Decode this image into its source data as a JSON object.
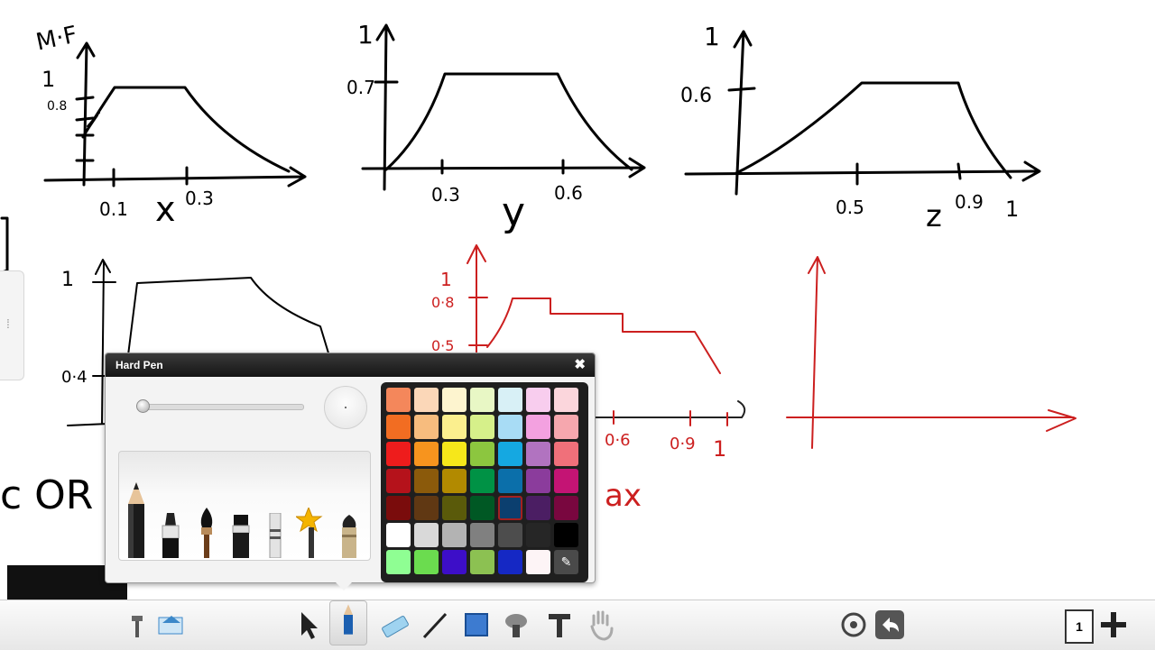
{
  "board": {
    "graph_x": {
      "axis_label": "M·F",
      "y_labels": [
        "1",
        "0.8"
      ],
      "x_labels": [
        "0.1",
        "0.3"
      ],
      "var": "x"
    },
    "graph_y": {
      "y_labels": [
        "1",
        "0.7"
      ],
      "x_labels": [
        "0.3",
        "0.6"
      ],
      "var": "y"
    },
    "graph_z": {
      "y_labels": [
        "1",
        "0.6"
      ],
      "x_labels": [
        "0.5",
        "0.9",
        "1"
      ],
      "var": "z"
    },
    "graph_left": {
      "y_labels": [
        "1",
        "0·4"
      ]
    },
    "graph_red": {
      "y_labels": [
        "1",
        "0·8",
        "0·5"
      ],
      "x_labels": [
        "0·6",
        "0·9",
        "1"
      ],
      "note": "ax"
    },
    "bottom_text": "c OR"
  },
  "pen_panel": {
    "title": "Hard Pen",
    "close_icon": "close-icon",
    "swatches": [
      [
        "#f4875b",
        "#fbd7b8",
        "#fdf4cf",
        "#e8f7c5",
        "#d8f0f6",
        "#f8cdee",
        "#fbd6dc"
      ],
      [
        "#f26d22",
        "#f7bc7e",
        "#fbef8e",
        "#d6f08a",
        "#a8dcf5",
        "#f3a1e0",
        "#f6a7ae"
      ],
      [
        "#ee1c1c",
        "#f7941e",
        "#f6e71a",
        "#8cc63f",
        "#15a8e1",
        "#b173c0",
        "#f0707a"
      ],
      [
        "#b5121b",
        "#8b5a0b",
        "#b28a00",
        "#009245",
        "#0b6faa",
        "#8b3c9c",
        "#c41474"
      ],
      [
        "#7a0c0c",
        "#603813",
        "#5a5a0a",
        "#005824",
        "#0b3f6f",
        "#4b1e63",
        "#79073f"
      ],
      [
        "#ffffff",
        "#d9d9d9",
        "#b3b3b3",
        "#808080",
        "#4d4d4d",
        "#262626",
        "#000000"
      ],
      [
        "#8ffe93",
        "#6bdc4f",
        "#3d0ec8",
        "#8cc152",
        "#1528c4",
        "#fdf4f6",
        "picker"
      ]
    ],
    "selected_swatch": "#0b3f6f"
  },
  "toolbar": {
    "page_number": "1",
    "icons": [
      "select-arrow-icon",
      "hard-pen-icon",
      "eraser-icon",
      "line-icon",
      "shape-icon",
      "fill-icon",
      "text-icon",
      "hand-icon",
      "target-icon",
      "undo-icon",
      "add-page-icon"
    ]
  }
}
